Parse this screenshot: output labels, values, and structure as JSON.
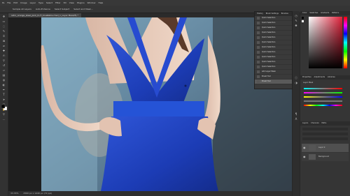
{
  "menubar": {
    "items": [
      "Ps",
      "File",
      "Edit",
      "Image",
      "Layer",
      "Type",
      "Select",
      "Filter",
      "3D",
      "View",
      "Plugins",
      "Window",
      "Help"
    ]
  },
  "options_bar": {
    "items": [
      "Sample All Layers",
      "Auto-Enhance",
      "Select Subject",
      "Select and Mask..."
    ]
  },
  "doc_tab": {
    "label": "retro_orange_steel_pink_hi-Fi_blueRetouched_1_Layer Mask/8) *"
  },
  "status": {
    "zoom": "33.33%",
    "info": "2560 px x 1440 px (72 ppi)"
  },
  "history": {
    "tabs": [
      "History",
      "Brush Settings",
      "Brushes"
    ],
    "items": [
      "Quick Selection",
      "Quick Selection",
      "Quick Selection",
      "Quick Selection",
      "Quick Selection",
      "Quick Selection",
      "Quick Selection",
      "Quick Selection",
      "Quick Selection",
      "Quick Selection",
      "Quick Selection",
      "Add Layer Mask",
      "Brush Tool",
      "Brush Tool"
    ],
    "active_index": 13
  },
  "color_panel": {
    "tabs": [
      "Color",
      "Swatches",
      "Gradients",
      "Patterns"
    ],
    "hue_color": "#e0213a"
  },
  "properties": {
    "tabs": [
      "Properties",
      "Adjustments",
      "Libraries"
    ],
    "title": "Layer Mask"
  },
  "layers": {
    "tabs": [
      "Layers",
      "Channels",
      "Paths"
    ],
    "rows": [
      {
        "name": "Layer 0",
        "selected": true
      },
      {
        "name": "Background",
        "selected": false
      }
    ]
  },
  "colors": {
    "dress": "#1f3fb8",
    "accent": "#2f6fd6"
  }
}
